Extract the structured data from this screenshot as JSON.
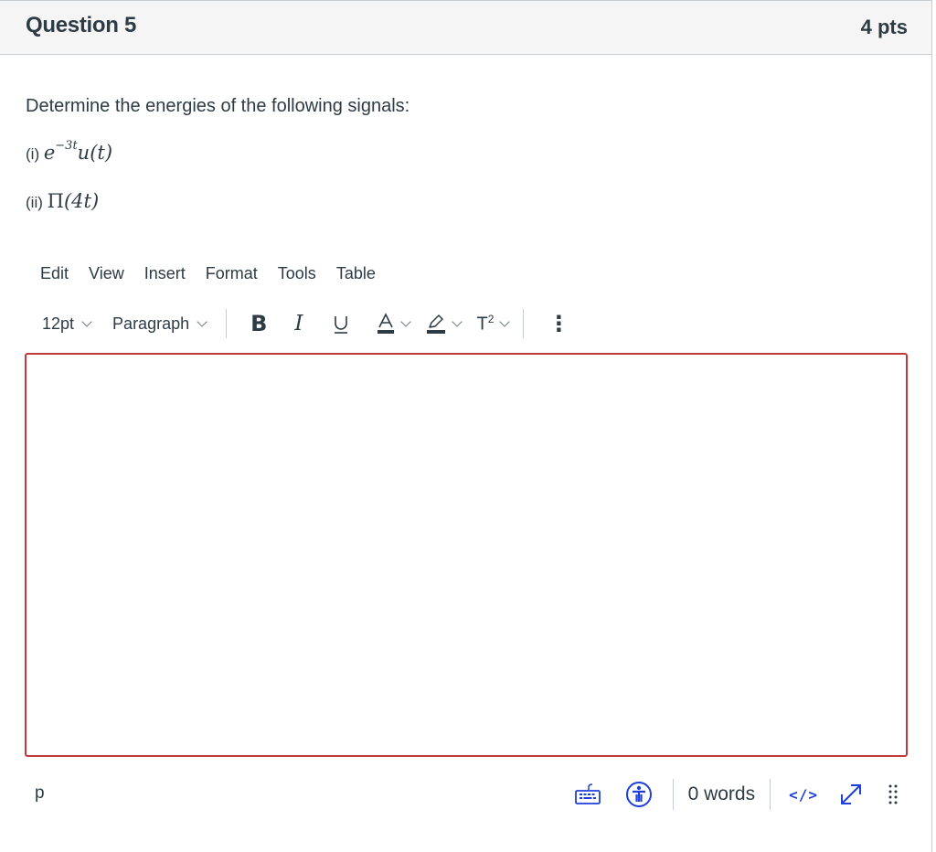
{
  "question": {
    "title": "Question 5",
    "points": "4 pts",
    "prompt": "Determine the energies of the following signals:",
    "items": [
      {
        "label": "(i)",
        "math_base": "e",
        "math_sup": "−3t",
        "math_rest": "u(t)"
      },
      {
        "label": "(ii)",
        "math_func": "Π",
        "math_rest": "(4t)"
      }
    ]
  },
  "editor": {
    "menu": [
      "Edit",
      "View",
      "Insert",
      "Format",
      "Tools",
      "Table"
    ],
    "toolbar": {
      "font_size": "12pt",
      "block_format": "Paragraph",
      "bold": "B",
      "italic": "I",
      "underline": "U",
      "text_color": "A",
      "superscript_base": "T",
      "superscript_exp": "2",
      "more": "⋮"
    },
    "content": "",
    "border_color": "#c0393b"
  },
  "statusbar": {
    "element_path": "p",
    "word_count": "0 words",
    "html_toggle": "</>",
    "accent_color": "#1f3fdb"
  }
}
